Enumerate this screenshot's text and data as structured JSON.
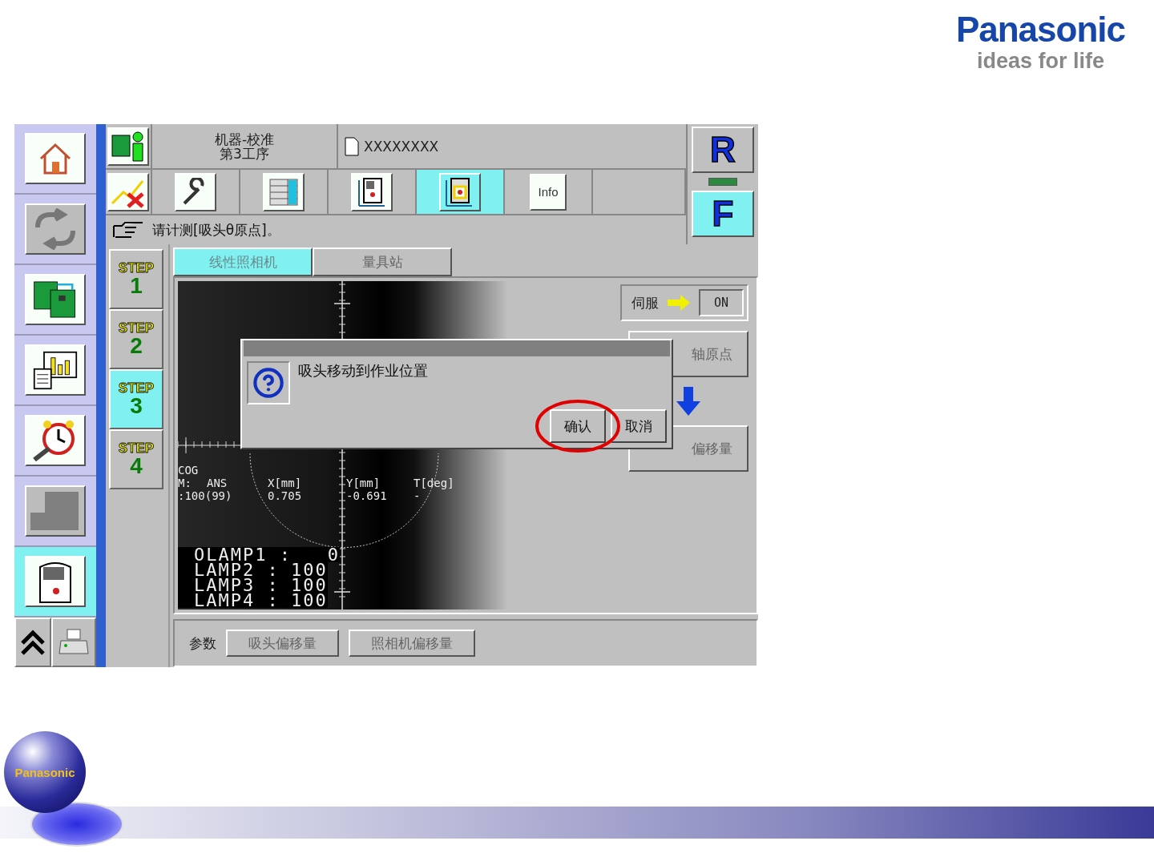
{
  "logo": {
    "brand": "Panasonic",
    "tagline": "ideas for life"
  },
  "sidebar": {
    "items": [
      {
        "kind": "home",
        "selected": false,
        "disabled": false
      },
      {
        "kind": "cycle",
        "selected": false,
        "disabled": true
      },
      {
        "kind": "boards",
        "selected": false,
        "disabled": false
      },
      {
        "kind": "report",
        "selected": false,
        "disabled": false
      },
      {
        "kind": "alarm",
        "selected": false,
        "disabled": false
      },
      {
        "kind": "blocks",
        "selected": false,
        "disabled": true
      },
      {
        "kind": "machine",
        "selected": true,
        "disabled": false
      }
    ],
    "bottom": [
      {
        "kind": "up"
      },
      {
        "kind": "printer"
      }
    ]
  },
  "header": {
    "title": "机器-校准",
    "subtitle": "第3工序",
    "file": "XXXXXXXX"
  },
  "toolbar": [
    {
      "kind": "wrench",
      "selected": false
    },
    {
      "kind": "table",
      "selected": false
    },
    {
      "kind": "machine",
      "selected": false
    },
    {
      "kind": "target",
      "selected": true
    },
    {
      "kind": "info",
      "selected": false,
      "label": "Info"
    }
  ],
  "message": "请计测[吸头θ原点]。",
  "side_keys": [
    {
      "label": "R",
      "selected": false
    },
    {
      "label": "F",
      "selected": true
    }
  ],
  "steps": [
    {
      "label": "STEP",
      "number": "1",
      "selected": false
    },
    {
      "label": "STEP",
      "number": "2",
      "selected": false
    },
    {
      "label": "STEP",
      "number": "3",
      "selected": true
    },
    {
      "label": "STEP",
      "number": "4",
      "selected": false
    }
  ],
  "tabs": [
    {
      "label": "线性照相机",
      "selected": true
    },
    {
      "label": "量具站",
      "selected": false
    }
  ],
  "camera": {
    "cog": "COG",
    "columns": [
      "M:",
      "ANS",
      "X[mm]",
      "Y[mm]",
      "T[deg]"
    ],
    "values": [
      ":100(99)",
      "0.705",
      "-0.691",
      "-"
    ],
    "lamps": [
      {
        "label": "OLAMP1 :",
        "value": "0"
      },
      {
        "label": "LAMP2 :",
        "value": "100"
      },
      {
        "label": "LAMP3 :",
        "value": "100"
      },
      {
        "label": "LAMP4 :",
        "value": "100"
      }
    ]
  },
  "servo": {
    "label": "伺服",
    "value": "ON"
  },
  "side_buttons": [
    "轴原点",
    "偏移量"
  ],
  "dialog": {
    "message": "吸头移动到作业位置",
    "buttons": [
      {
        "label": "确认",
        "highlighted": true
      },
      {
        "label": "取消",
        "highlighted": false
      }
    ]
  },
  "params": {
    "label": "参数",
    "buttons": [
      "吸头偏移量",
      "照相机偏移量"
    ]
  },
  "footer": {
    "brand": "Panasonic"
  }
}
